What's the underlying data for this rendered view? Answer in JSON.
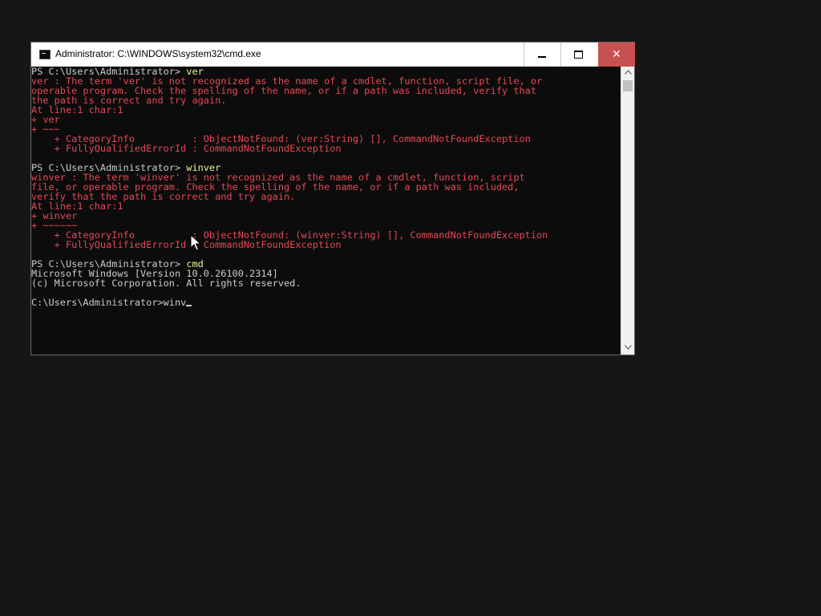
{
  "window": {
    "title": "Administrator: C:\\WINDOWS\\system32\\cmd.exe",
    "buttons": {
      "minimize": "minimize",
      "maximize": "maximize",
      "close": "✕"
    }
  },
  "colors": {
    "error_text": "#e74856",
    "normal_text": "#cccccc",
    "command_text": "#f0f0a0",
    "close_button": "#c75050",
    "console_background": "#0c0c0c"
  },
  "console": {
    "lines": [
      {
        "type": "prompt",
        "prompt": "PS C:\\Users\\Administrator> ",
        "cmd": "ver"
      },
      {
        "type": "err",
        "text": "ver : The term 'ver' is not recognized as the name of a cmdlet, function, script file, or"
      },
      {
        "type": "err",
        "text": "operable program. Check the spelling of the name, or if a path was included, verify that"
      },
      {
        "type": "err",
        "text": "the path is correct and try again."
      },
      {
        "type": "err",
        "text": "At line:1 char:1"
      },
      {
        "type": "err",
        "text": "+ ver"
      },
      {
        "type": "err",
        "text": "+ ~~~"
      },
      {
        "type": "err",
        "text": "    + CategoryInfo          : ObjectNotFound: (ver:String) [], CommandNotFoundException"
      },
      {
        "type": "err",
        "text": "    + FullyQualifiedErrorId : CommandNotFoundException"
      },
      {
        "type": "norm",
        "text": ""
      },
      {
        "type": "prompt",
        "prompt": "PS C:\\Users\\Administrator> ",
        "cmd": "winver"
      },
      {
        "type": "err",
        "text": "winver : The term 'winver' is not recognized as the name of a cmdlet, function, script"
      },
      {
        "type": "err",
        "text": "file, or operable program. Check the spelling of the name, or if a path was included,"
      },
      {
        "type": "err",
        "text": "verify that the path is correct and try again."
      },
      {
        "type": "err",
        "text": "At line:1 char:1"
      },
      {
        "type": "err",
        "text": "+ winver"
      },
      {
        "type": "err",
        "text": "+ ~~~~~~"
      },
      {
        "type": "err",
        "text": "    + CategoryInfo          : ObjectNotFound: (winver:String) [], CommandNotFoundException"
      },
      {
        "type": "err",
        "text": "    + FullyQualifiedErrorId : CommandNotFoundException"
      },
      {
        "type": "norm",
        "text": ""
      },
      {
        "type": "prompt",
        "prompt": "PS C:\\Users\\Administrator> ",
        "cmd": "cmd"
      },
      {
        "type": "norm",
        "text": "Microsoft Windows [Version 10.0.26100.2314]"
      },
      {
        "type": "norm",
        "text": "(c) Microsoft Corporation. All rights reserved."
      },
      {
        "type": "norm",
        "text": ""
      },
      {
        "type": "input",
        "text": "C:\\Users\\Administrator>winv"
      }
    ]
  },
  "icons": {
    "app": "console-icon",
    "scroll_up": "arrow-up-icon",
    "scroll_down": "arrow-down-icon",
    "pointer": "mouse-pointer-icon"
  }
}
